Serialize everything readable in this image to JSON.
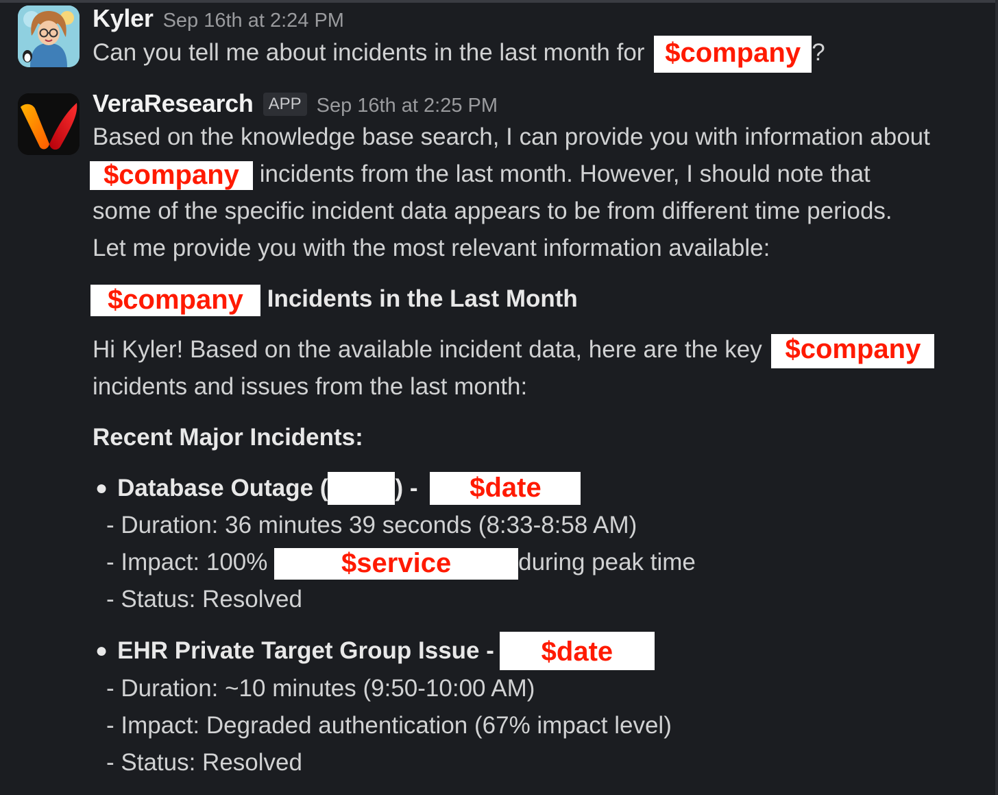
{
  "messages": [
    {
      "author": "Kyler",
      "time": "Sep 16th at 2:24 PM",
      "text_pre": "Can you tell me about incidents in the last month for",
      "redact": "$company",
      "text_post": "?"
    },
    {
      "author": "VeraResearch",
      "badge": "APP",
      "time": "Sep 16th at 2:25 PM",
      "intro_line1": "Based on the knowledge base search, I can provide you with information about",
      "intro_redact": "$company",
      "intro_line2": " incidents from the last month. However, I should note that",
      "intro_line3": "some of the specific incident data appears to be from different time periods.",
      "intro_line4": "Let me provide you with the most relevant information available:",
      "heading_redact": "$company",
      "heading_text": "Incidents in the Last Month",
      "greeting_pre": "Hi Kyler! Based on the available incident data, here are the key",
      "greeting_redact": "$company",
      "greeting_post": "incidents and issues from the last month:",
      "section_title": "Recent Major Incidents:",
      "incidents": [
        {
          "title_pre": "Database Outage (",
          "title_mid": ") -",
          "date_redact": "$date",
          "duration": "- Duration: 36 minutes 39 seconds (8:33-8:58 AM)",
          "impact_pre": "- Impact: 100%",
          "impact_redact": "$service",
          "impact_post": "during peak time",
          "status": "- Status: Resolved"
        },
        {
          "title_pre": "EHR Private Target Group Issue -",
          "date_redact": "$date",
          "duration": "- Duration: ~10 minutes (9:50-10:00 AM)",
          "impact": "- Impact: Degraded authentication (67% impact level)",
          "status": "- Status: Resolved"
        }
      ]
    }
  ],
  "colors": {
    "background": "#1b1d21",
    "text": "#d1d2d3",
    "redact_fill": "#ffffff",
    "redact_text": "#ff1a00"
  }
}
